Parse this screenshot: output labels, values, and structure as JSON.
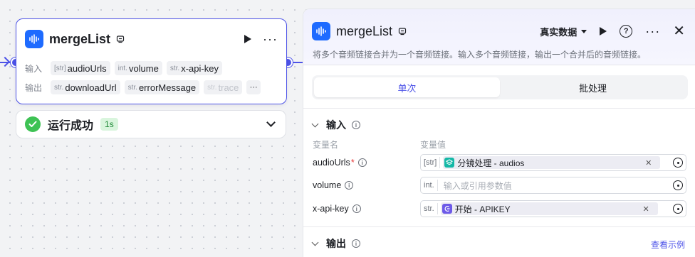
{
  "node": {
    "title": "mergeList",
    "input_label": "输入",
    "output_label": "输出",
    "inputs": [
      {
        "type": "[str]",
        "name": "audioUrls"
      },
      {
        "type": "int.",
        "name": "volume"
      },
      {
        "type": "str.",
        "name": "x-api-key"
      }
    ],
    "outputs": [
      {
        "type": "str.",
        "name": "downloadUrl"
      },
      {
        "type": "str.",
        "name": "errorMessage"
      },
      {
        "type": "str.",
        "name": "trace"
      }
    ],
    "more_label": "···"
  },
  "status": {
    "text": "运行成功",
    "duration": "1s"
  },
  "panel": {
    "title": "mergeList",
    "data_mode": "真实数据",
    "help_label": "?",
    "description": "将多个音频链接合并为一个音频链接。输入多个音频链接，输出一个合并后的音频链接。",
    "tabs": [
      {
        "label": "单次",
        "active": true
      },
      {
        "label": "批处理",
        "active": false
      }
    ],
    "input_section": "输入",
    "col_name": "变量名",
    "col_value": "变量值",
    "params": [
      {
        "name": "audioUrls",
        "required": true,
        "type": "[str]",
        "ref_label": "分镜处理 - audios",
        "ref_icon": "layers-icon"
      },
      {
        "name": "volume",
        "required": false,
        "type": "int.",
        "placeholder": "输入或引用参数值"
      },
      {
        "name": "x-api-key",
        "required": false,
        "type": "str.",
        "ref_label": "开始 - APIKEY",
        "ref_icon": "start-icon"
      }
    ],
    "output_section": "输出",
    "example_link": "查看示例"
  },
  "colors": {
    "accent": "#4d53e8",
    "app_icon": "#1e6bff",
    "success": "#3ec254",
    "ref_teal": "#14b8a6",
    "ref_purple": "#6d5ae8"
  }
}
